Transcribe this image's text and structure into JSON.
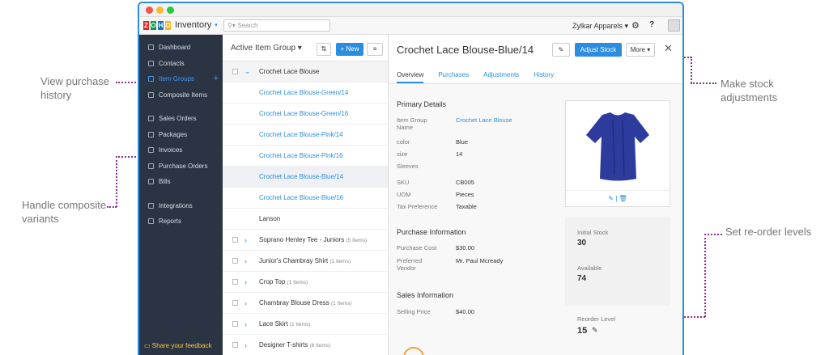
{
  "callouts": {
    "purchase": "View purchase history",
    "composite": "Handle composite variants",
    "stock": "Make stock adjustments",
    "reorder": "Set re-order levels"
  },
  "app": {
    "logo_letters": [
      "Z",
      "O",
      "H",
      "O"
    ],
    "name": "Inventory",
    "search_placeholder": "Search",
    "org": "Zylkar Apparels"
  },
  "sidebar": {
    "items": [
      "Dashboard",
      "Contacts",
      "Item Groups",
      "Composite Items",
      "Sales Orders",
      "Packages",
      "Invoices",
      "Purchase Orders",
      "Bills",
      "Integrations",
      "Reports"
    ],
    "feedback": "Share your feedback"
  },
  "list": {
    "title": "Active Item Group",
    "new_label": "New",
    "group": "Crochet Lace Blouse",
    "variants": [
      "Crochet Lace Blouse-Green/14",
      "Crochet Lace Blouse-Green/16",
      "Crochet Lace Blouse-Pink/14",
      "Crochet Lace Blouse-Pink/16",
      "Crochet Lace Blouse-Blue/14",
      "Crochet Lace Blouse-Blue/16"
    ],
    "lanson": "Lanson",
    "groups": [
      {
        "name": "Soprano Henley Tee - Juniors",
        "count": "(5 Items)"
      },
      {
        "name": "Junior's Chambray Shirt",
        "count": "(1 Items)"
      },
      {
        "name": "Crop Top",
        "count": "(1 Items)"
      },
      {
        "name": "Chambray Blouse Dress",
        "count": "(1 Items)"
      },
      {
        "name": "Lace Skirt",
        "count": "(1 Items)"
      },
      {
        "name": "Designer T-shirts",
        "count": "(6 Items)"
      }
    ]
  },
  "detail": {
    "title": "Crochet Lace Blouse-Blue/14",
    "adjust": "Adjust Stock",
    "more": "More",
    "tabs": [
      "Overview",
      "Purchases",
      "Adjustments",
      "History"
    ],
    "primary": "Primary Details",
    "fields": [
      [
        "Item Group Name",
        "Crochet Lace Blouse"
      ],
      [
        "color",
        "Blue"
      ],
      [
        "size",
        "14"
      ],
      [
        "Sleeves",
        ""
      ],
      [
        "SKU",
        "CB005"
      ],
      [
        "UOM",
        "Pieces"
      ],
      [
        "Tax Preference",
        "Taxable"
      ]
    ],
    "purchase_info": "Purchase Information",
    "purchase_cost_label": "Purchase Cost",
    "purchase_cost": "$30.00",
    "vendor_label": "Preferred Vendor",
    "vendor": "Mr. Paul Mcready",
    "sales_info": "Sales Information",
    "selling_label": "Selling Price",
    "selling": "$40.00",
    "initial_label": "Initial Stock",
    "initial": "30",
    "available_label": "Available",
    "available": "74",
    "reorder_label": "Reorder Level",
    "reorder": "15"
  }
}
